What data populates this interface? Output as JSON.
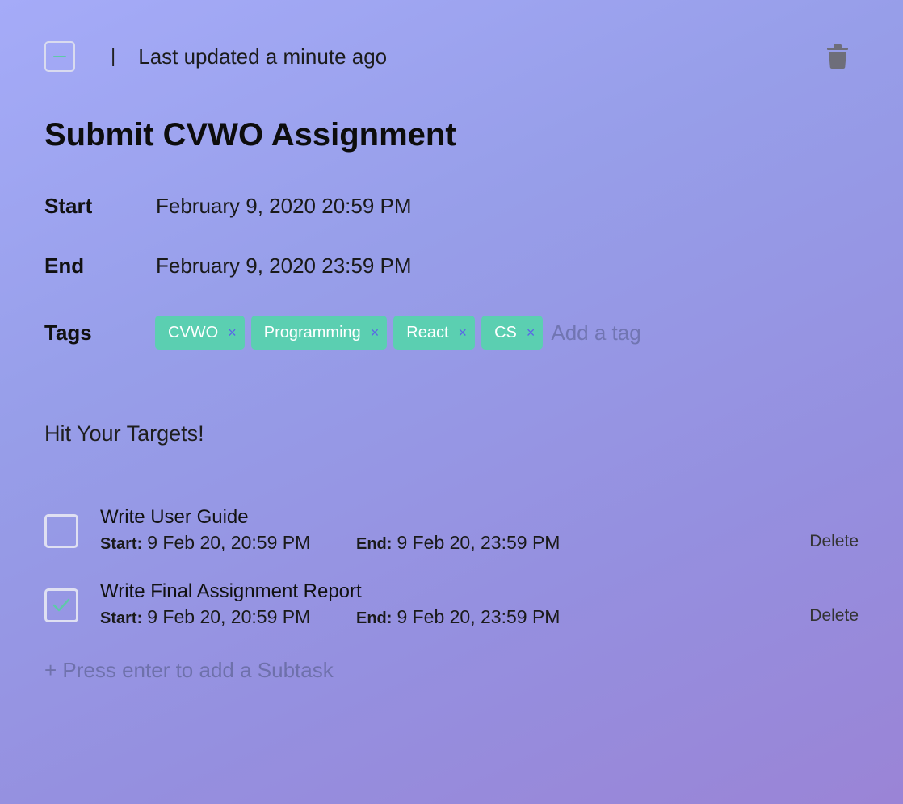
{
  "header": {
    "separator": "|",
    "last_updated": "Last updated a minute ago"
  },
  "task": {
    "title": "Submit CVWO Assignment",
    "start_label": "Start",
    "start_value": "February 9, 2020 20:59 PM",
    "end_label": "End",
    "end_value": "February 9, 2020 23:59 PM",
    "tags_label": "Tags",
    "tags": [
      "CVWO",
      "Programming",
      "React",
      "CS"
    ],
    "tag_remove_glyph": "×",
    "tag_placeholder": "Add a tag",
    "description": "Hit Your Targets!"
  },
  "subtasks": [
    {
      "title": "Write User Guide",
      "start_label": "Start:",
      "start_value": "9 Feb 20, 20:59 PM",
      "end_label": "End:",
      "end_value": "9 Feb 20, 23:59 PM",
      "delete_label": "Delete",
      "completed": false
    },
    {
      "title": "Write Final Assignment Report",
      "start_label": "Start:",
      "start_value": "9 Feb 20, 20:59 PM",
      "end_label": "End:",
      "end_value": "9 Feb 20, 23:59 PM",
      "delete_label": "Delete",
      "completed": true
    }
  ],
  "add_subtask_placeholder": "+ Press enter to add a Subtask",
  "colors": {
    "tag_background": "#5bcfb1",
    "tag_remove": "#5a63e8",
    "check_mark": "#5ec9a8",
    "trash_icon": "#6e6e7a"
  },
  "icons": {
    "task_checkbox": "minus-icon",
    "delete_task": "trash-icon",
    "subtask_checked": "check-icon"
  }
}
